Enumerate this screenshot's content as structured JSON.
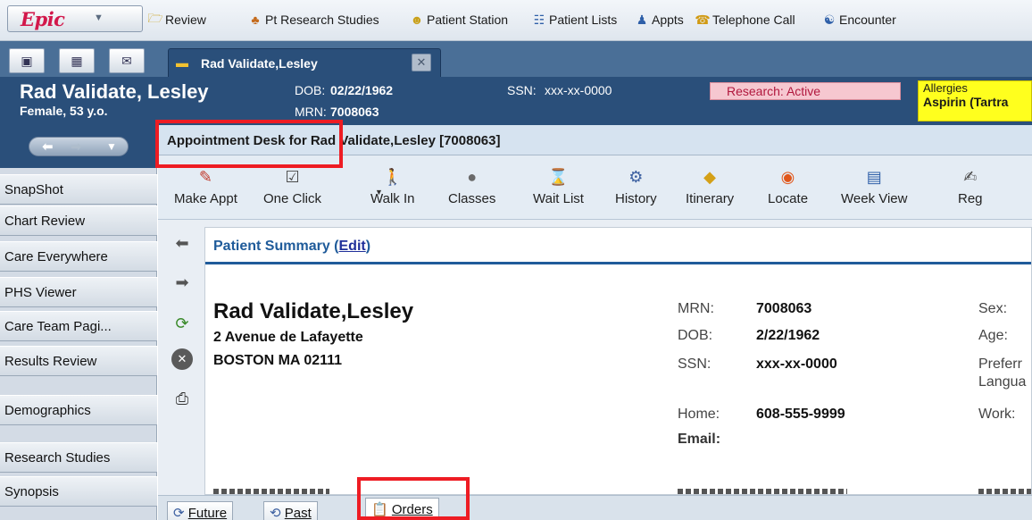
{
  "topbar": {
    "logo": "Epic",
    "items": [
      {
        "label": "Review",
        "icon": "review-icon"
      },
      {
        "label": "Pt Research Studies",
        "icon": "research-studies-icon"
      },
      {
        "label": "Patient Station",
        "icon": "patient-station-icon"
      },
      {
        "label": "Patient Lists",
        "icon": "patient-lists-icon"
      },
      {
        "label": "Appts",
        "icon": "appts-icon"
      },
      {
        "label": "Telephone Call",
        "icon": "telephone-icon"
      },
      {
        "label": "Encounter",
        "icon": "encounter-icon"
      }
    ]
  },
  "tab": {
    "label": "Rad Validate,Lesley"
  },
  "header": {
    "name": "Rad Validate, Lesley",
    "sex_age": "Female, 53 y.o.",
    "dob_label": "DOB:",
    "dob": "02/22/1962",
    "mrn_label": "MRN:",
    "mrn": "7008063",
    "ssn_label": "SSN:",
    "ssn": "xxx-xx-0000",
    "research_label": "Research:",
    "research_status": "Active",
    "allergies_label": "Allergies",
    "allergies_value": "Aspirin (Tartra"
  },
  "sidebar": {
    "items": [
      "SnapShot",
      "Chart Review",
      "Care Everywhere",
      "PHS Viewer",
      "Care Team Pagi...",
      "Results Review",
      "Demographics",
      "Research Studies",
      "Synopsis"
    ]
  },
  "activity": {
    "title": "Appointment Desk for Rad Validate,Lesley [7008063]",
    "buttons": [
      {
        "label": "Make Appt",
        "icon": "make-appt-icon"
      },
      {
        "label": "One Click",
        "icon": "one-click-icon"
      },
      {
        "label": "Walk In",
        "icon": "walk-in-icon"
      },
      {
        "label": "Classes",
        "icon": "classes-icon"
      },
      {
        "label": "Wait List",
        "icon": "wait-list-icon"
      },
      {
        "label": "History",
        "icon": "history-icon"
      },
      {
        "label": "Itinerary",
        "icon": "itinerary-icon"
      },
      {
        "label": "Locate",
        "icon": "locate-icon"
      },
      {
        "label": "Week View",
        "icon": "week-view-icon"
      },
      {
        "label": "Reg",
        "icon": "reg-icon"
      }
    ]
  },
  "summary": {
    "title": "Patient Summary",
    "edit_link": "Edit",
    "name": "Rad Validate,Lesley",
    "address_line1": "2 Avenue de Lafayette",
    "address_line2": "BOSTON MA 02111",
    "mrn_label": "MRN:",
    "mrn": "7008063",
    "dob_label": "DOB:",
    "dob": "2/22/1962",
    "ssn_label": "SSN:",
    "ssn": "xxx-xx-0000",
    "home_label": "Home:",
    "home": "608-555-9999",
    "email_label": "Email:",
    "sex_label": "Sex:",
    "age_label": "Age:",
    "preferred_label": "Preferr",
    "language_label": "Langua",
    "work_label": "Work:"
  },
  "bottom_tabs": [
    {
      "label": "Future",
      "icon": "future-icon"
    },
    {
      "label": "Past",
      "icon": "past-icon"
    },
    {
      "label": "Orders",
      "icon": "orders-icon"
    }
  ],
  "colors": {
    "header_bg": "#2a4f7a",
    "callout_red": "#ee1c23",
    "allergy_yellow": "#ffff1e",
    "research_pink": "#f6c7d0",
    "link_blue": "#1f5b9a"
  }
}
